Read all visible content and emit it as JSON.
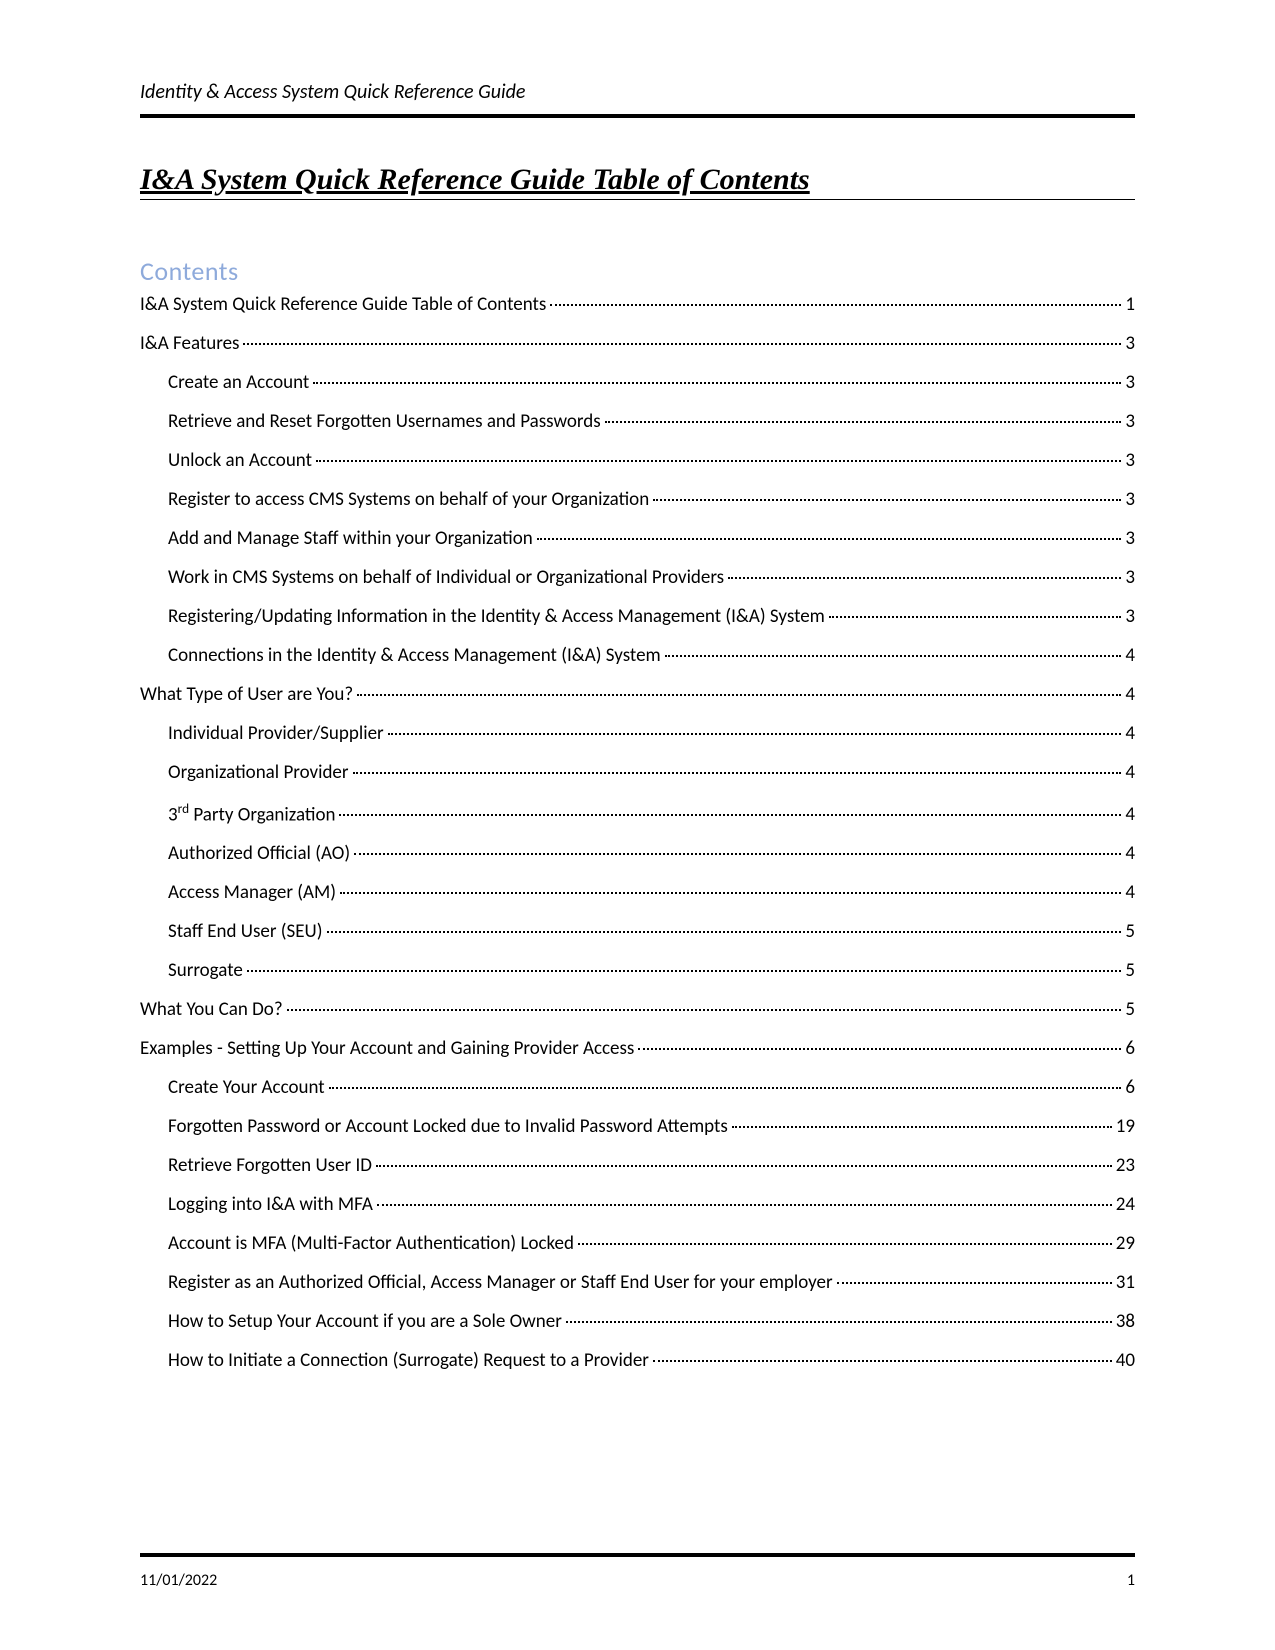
{
  "header": {
    "text": "Identity & Access System Quick Reference Guide"
  },
  "title": "I&A System Quick Reference Guide Table of Contents",
  "contents_label": "Contents",
  "toc": [
    {
      "label": "I&A System Quick Reference Guide Table of Contents",
      "page": "1",
      "level": 1
    },
    {
      "label": "I&A Features",
      "page": "3",
      "level": 1
    },
    {
      "label": "Create an Account",
      "page": "3",
      "level": 2
    },
    {
      "label": "Retrieve and Reset Forgotten Usernames and Passwords",
      "page": "3",
      "level": 2
    },
    {
      "label": "Unlock an Account",
      "page": "3",
      "level": 2
    },
    {
      "label": "Register to access CMS Systems on behalf of your Organization",
      "page": "3",
      "level": 2
    },
    {
      "label": "Add and Manage Staff within your Organization",
      "page": "3",
      "level": 2
    },
    {
      "label": "Work in CMS Systems on behalf of Individual or Organizational Providers",
      "page": "3",
      "level": 2
    },
    {
      "label": "Registering/Updating Information in the Identity & Access Management (I&A) System",
      "page": "3",
      "level": 2
    },
    {
      "label": "Connections in the Identity & Access Management (I&A) System",
      "page": "4",
      "level": 2
    },
    {
      "label": "What Type of User are You?",
      "page": "4",
      "level": 1
    },
    {
      "label": "Individual Provider/Supplier",
      "page": "4",
      "level": 2
    },
    {
      "label": "Organizational Provider",
      "page": "4",
      "level": 2
    },
    {
      "label": "3rd Party Organization",
      "page": "4",
      "level": 2,
      "sup_after": "3",
      "sup": "rd",
      "rest": " Party Organization"
    },
    {
      "label": "Authorized Official (AO)",
      "page": "4",
      "level": 2
    },
    {
      "label": "Access Manager (AM)",
      "page": "4",
      "level": 2
    },
    {
      "label": "Staff End User (SEU)",
      "page": "5",
      "level": 2
    },
    {
      "label": "Surrogate",
      "page": "5",
      "level": 2
    },
    {
      "label": "What You Can Do?",
      "page": "5",
      "level": 1
    },
    {
      "label": "Examples - Setting Up Your Account and Gaining Provider Access",
      "page": "6",
      "level": 1
    },
    {
      "label": "Create Your Account",
      "page": "6",
      "level": 2
    },
    {
      "label": "Forgotten Password or Account Locked due to Invalid Password Attempts",
      "page": "19",
      "level": 2
    },
    {
      "label": "Retrieve Forgotten User ID",
      "page": "23",
      "level": 2
    },
    {
      "label": "Logging into I&A with MFA",
      "page": "24",
      "level": 2
    },
    {
      "label": "Account is MFA (Multi-Factor Authentication) Locked",
      "page": "29",
      "level": 2
    },
    {
      "label": "Register as an Authorized Official, Access Manager or Staff End User for your employer",
      "page": "31",
      "level": 2
    },
    {
      "label": "How to Setup Your Account if you are a Sole Owner",
      "page": "38",
      "level": 2
    },
    {
      "label": "How to Initiate a Connection (Surrogate) Request to a Provider",
      "page": "40",
      "level": 2
    }
  ],
  "footer": {
    "date": "11/01/2022",
    "page_number": "1"
  }
}
